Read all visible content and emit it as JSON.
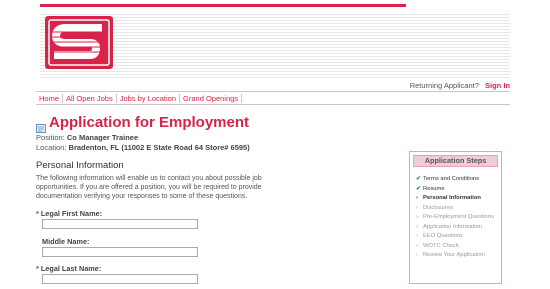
{
  "header": {
    "returning_label": "Returning Applicant?",
    "signin_label": "Sign In",
    "brand_color": "#d8234a"
  },
  "nav": {
    "items": [
      {
        "label": "Home"
      },
      {
        "label": "All Open Jobs"
      },
      {
        "label": "Jobs by Location"
      },
      {
        "label": "Grand Openings"
      }
    ]
  },
  "page": {
    "title": "Application for Employment",
    "position_label": "Position:",
    "position_value": "Co Manager Trainee",
    "location_label": "Location:",
    "location_value": "Bradenton, FL  (11002 E State Road 64 Store# 6595)"
  },
  "form": {
    "section_title": "Personal Information",
    "intro": "The following information will enable us to contact you about possible job opportunities. If you are offered a position, you will be required to provide documentation verifying your responses to some of these questions.",
    "fields": [
      {
        "label": "Legal First Name:",
        "required": true,
        "value": ""
      },
      {
        "label": "Middle Name:",
        "required": false,
        "value": ""
      },
      {
        "label": "Legal Last Name:",
        "required": true,
        "value": ""
      }
    ],
    "required_marker": "*"
  },
  "steps": {
    "title": "Application Steps",
    "check_mark": "✔",
    "current_mark": "›",
    "items": [
      {
        "label": "Terms and Conditions",
        "state": "done"
      },
      {
        "label": "Resume",
        "state": "done"
      },
      {
        "label": "Personal Information",
        "state": "current"
      },
      {
        "label": "Disclosures",
        "state": "pending"
      },
      {
        "label": "Pre-Employment Questions",
        "state": "pending"
      },
      {
        "label": "Application Information",
        "state": "pending"
      },
      {
        "label": "EEO Questions",
        "state": "pending"
      },
      {
        "label": "WOTC Check",
        "state": "pending"
      },
      {
        "label": "Review Your Application",
        "state": "pending"
      }
    ]
  },
  "icons": {
    "logo": "speedway-s-logo",
    "title_icon": "form-icon"
  }
}
